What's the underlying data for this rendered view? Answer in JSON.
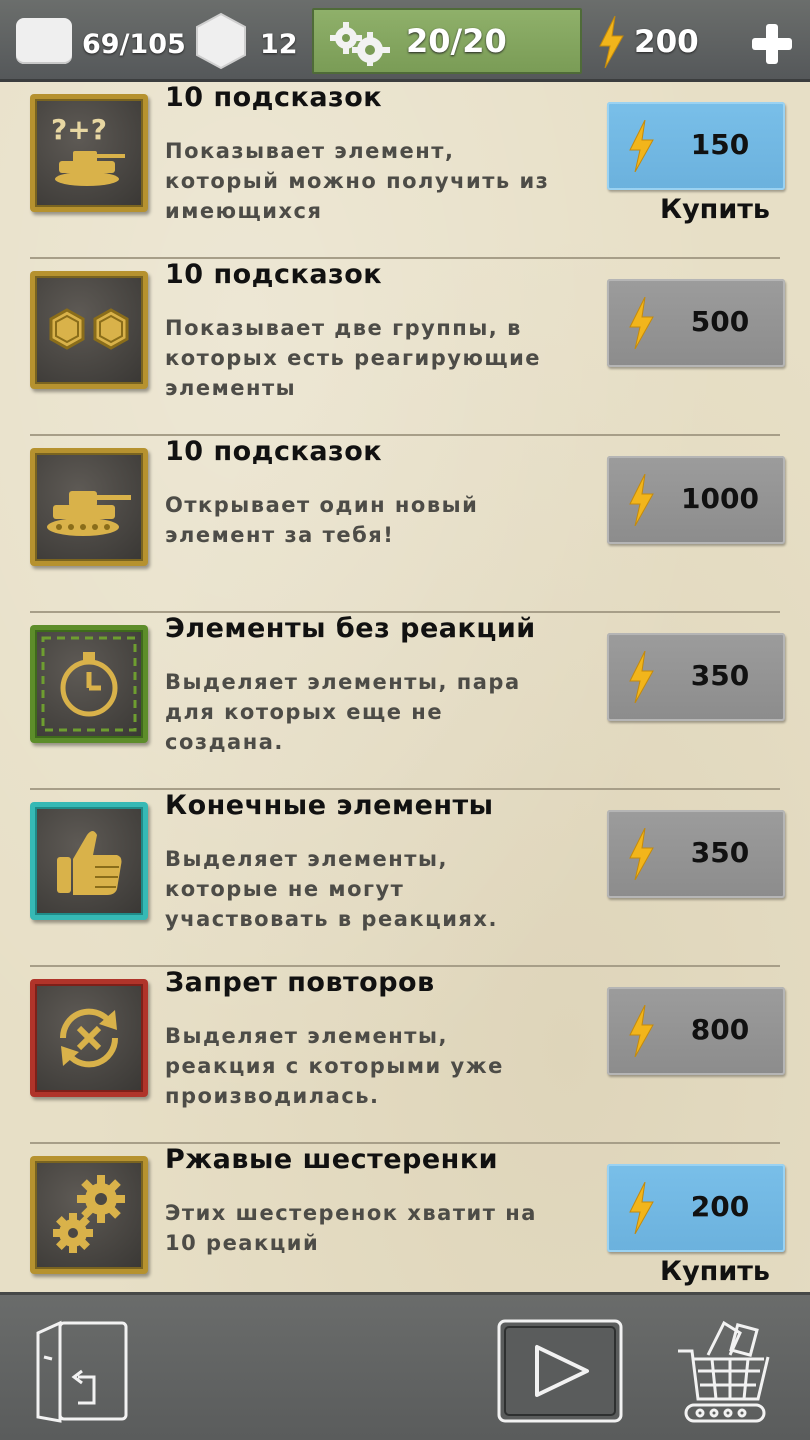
{
  "topbar": {
    "elements_count": "69/105",
    "hex_count": "12",
    "gears_count": "20/20",
    "energy": "200"
  },
  "items": [
    {
      "title": "10 подсказок",
      "description": "Показывает элемент, который можно получить из имеющихся",
      "price": "150",
      "active": true,
      "buy_label": "Купить",
      "icon": "question-tank-icon"
    },
    {
      "title": "10 подсказок",
      "description": "Показывает две группы, в которых есть реагирующие элементы",
      "price": "500",
      "active": false,
      "icon": "two-hexagons-icon"
    },
    {
      "title": "10 подсказок",
      "description": "Открывает один новый элемент за тебя!",
      "price": "1000",
      "active": false,
      "icon": "tank-icon"
    },
    {
      "title": "Элементы без реакций",
      "description": "Выделяет элементы, пара для которых еще не создана.",
      "price": "350",
      "active": false,
      "icon": "stopwatch-icon"
    },
    {
      "title": "Конечные элементы",
      "description": "Выделяет элементы, которые не могут участвовать в реакциях.",
      "price": "350",
      "active": false,
      "icon": "thumbs-up-icon"
    },
    {
      "title": "Запрет повторов",
      "description": "Выделяет элементы, реакция с которыми уже производилась.",
      "price": "800",
      "active": false,
      "icon": "no-repeat-icon"
    },
    {
      "title": "Ржавые шестеренки",
      "description": "Этих шестеренок хватит на 10 реакций",
      "price": "200",
      "active": true,
      "buy_label": "Купить",
      "icon": "gears-icon"
    }
  ],
  "bottombar": {
    "left_icon": "exit-door-icon",
    "center_icon": "play-icon",
    "right_icon": "shop-cart-icon"
  }
}
